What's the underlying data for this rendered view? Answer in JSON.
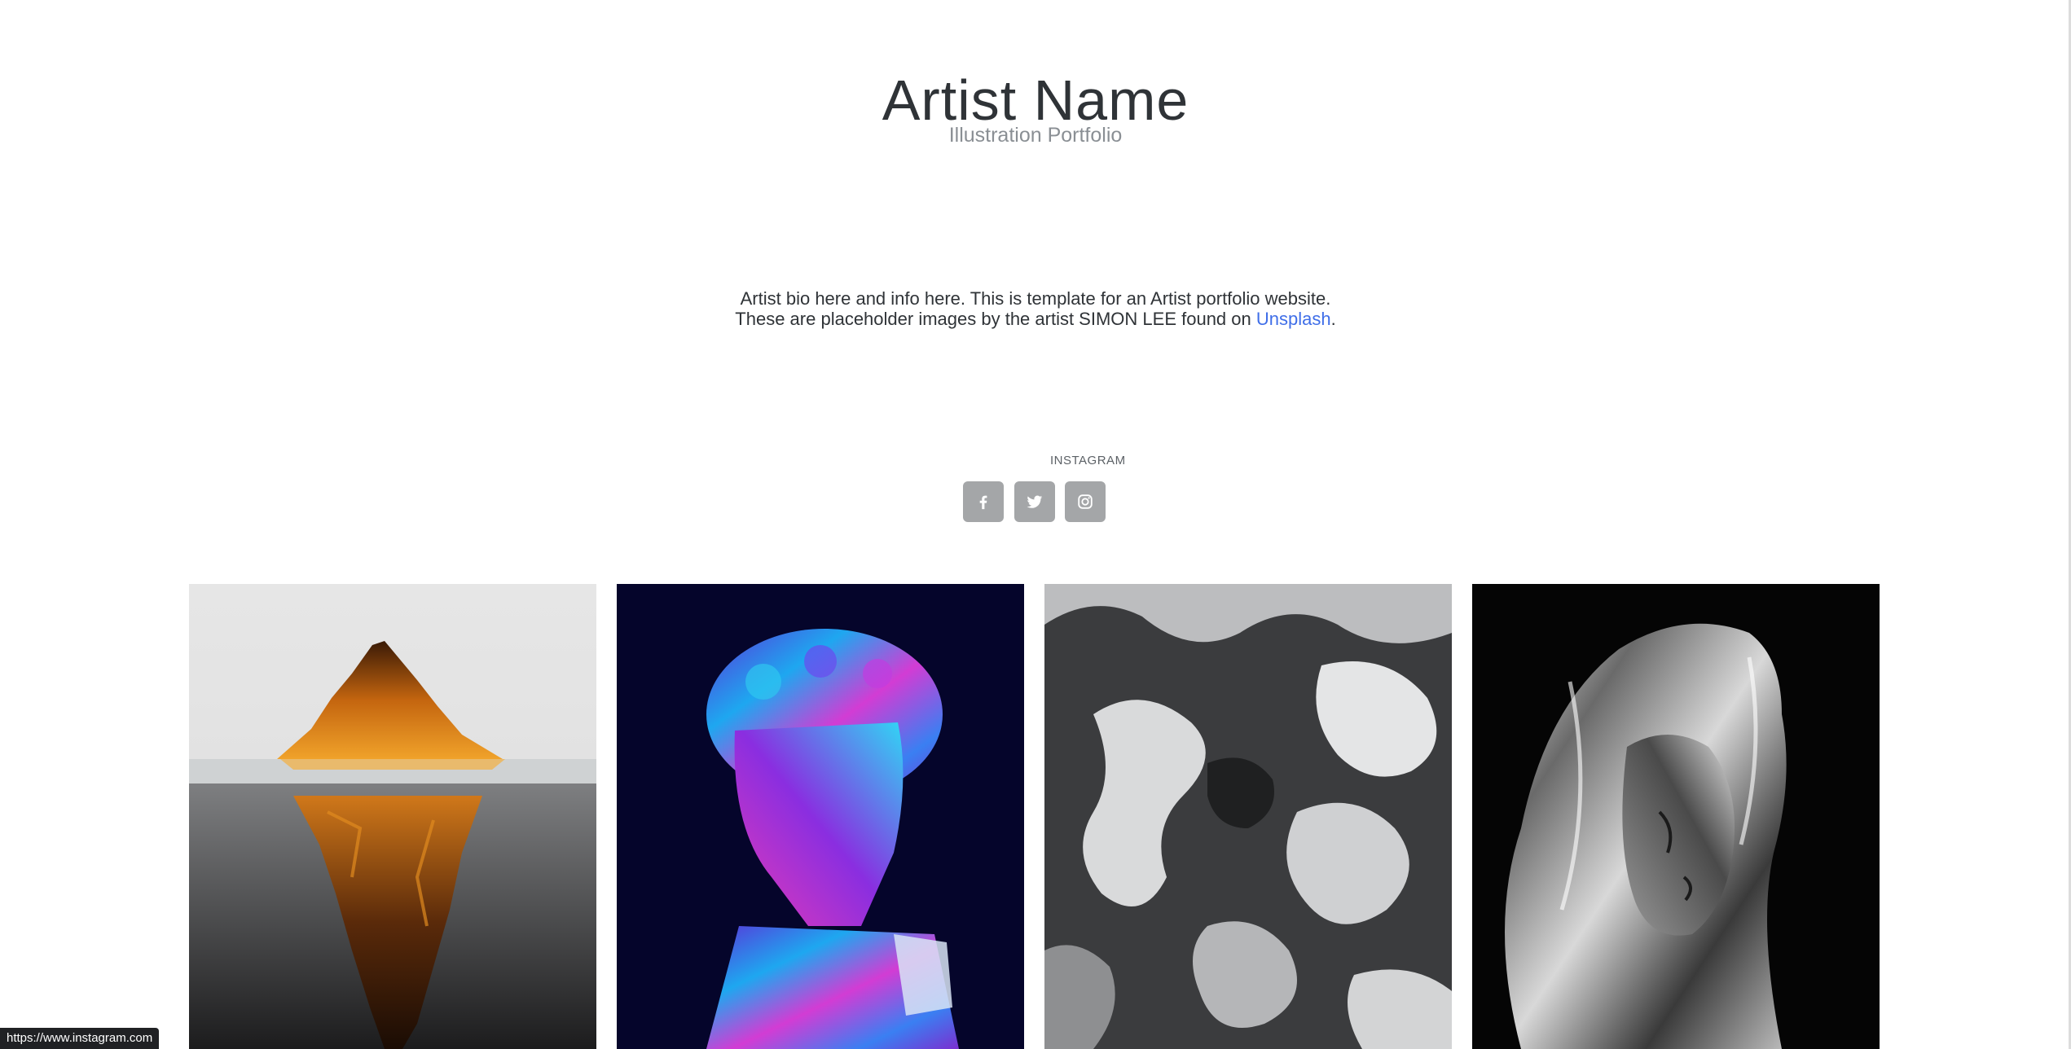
{
  "header": {
    "title": "Artist Name",
    "subtitle": "Illustration Portfolio"
  },
  "bio": {
    "line1": "Artist bio here and info here. This is template for an Artist portfolio website.",
    "line2_prefix": "These are placeholder images by the artist SIMON LEE found on ",
    "link_text": "Unsplash",
    "line2_suffix": "."
  },
  "social": {
    "hover_label": "INSTAGRAM",
    "buttons": [
      {
        "name": "facebook",
        "icon": "facebook-icon"
      },
      {
        "name": "twitter",
        "icon": "twitter-icon"
      },
      {
        "name": "instagram",
        "icon": "instagram-icon"
      }
    ],
    "button_color": "#a4a6a8"
  },
  "gallery": {
    "images": [
      {
        "subject": "lava-iceberg"
      },
      {
        "subject": "holographic-bust"
      },
      {
        "subject": "monochrome-topography"
      },
      {
        "subject": "chrome-veiled-statue"
      }
    ]
  },
  "status_bar": {
    "url": "https://www.instagram.com"
  },
  "colors": {
    "text": "#2f3337",
    "subtle_text": "#8a8f94",
    "link": "#3f6ee8"
  }
}
